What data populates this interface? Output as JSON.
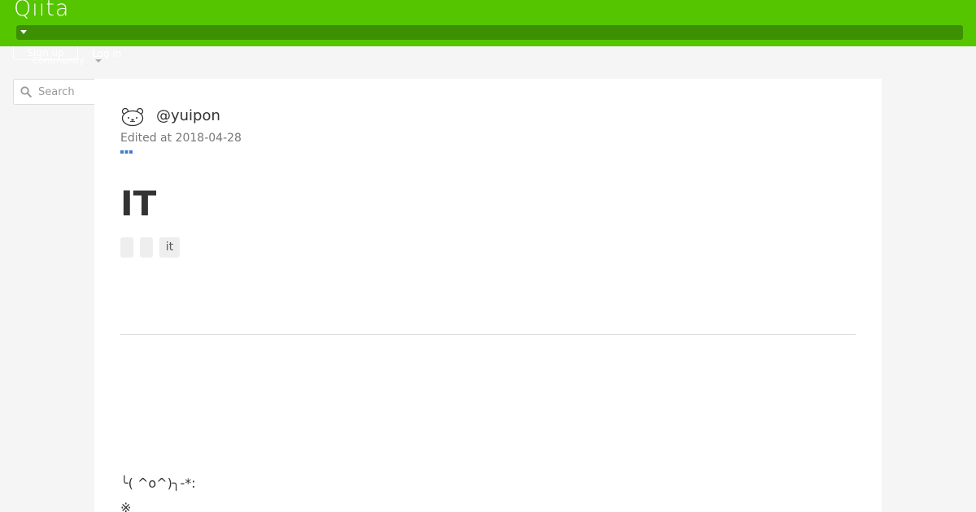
{
  "header": {
    "logo": "Qiita",
    "signup_label": "Sign up",
    "login_label": "Log in",
    "community_label": "Community",
    "bg_color": "#55c500"
  },
  "search": {
    "placeholder": "Search",
    "icon": "search-icon"
  },
  "article": {
    "author": "@yuipon",
    "avatar_icon": "bear-face-icon",
    "edited": "Edited at 2018-04-28",
    "menu_icon": "more-dots-icon",
    "title": "IT",
    "tags": [
      "",
      "",
      "it"
    ],
    "body": [
      "╰( ^o^)╮-*:",
      "※"
    ]
  }
}
